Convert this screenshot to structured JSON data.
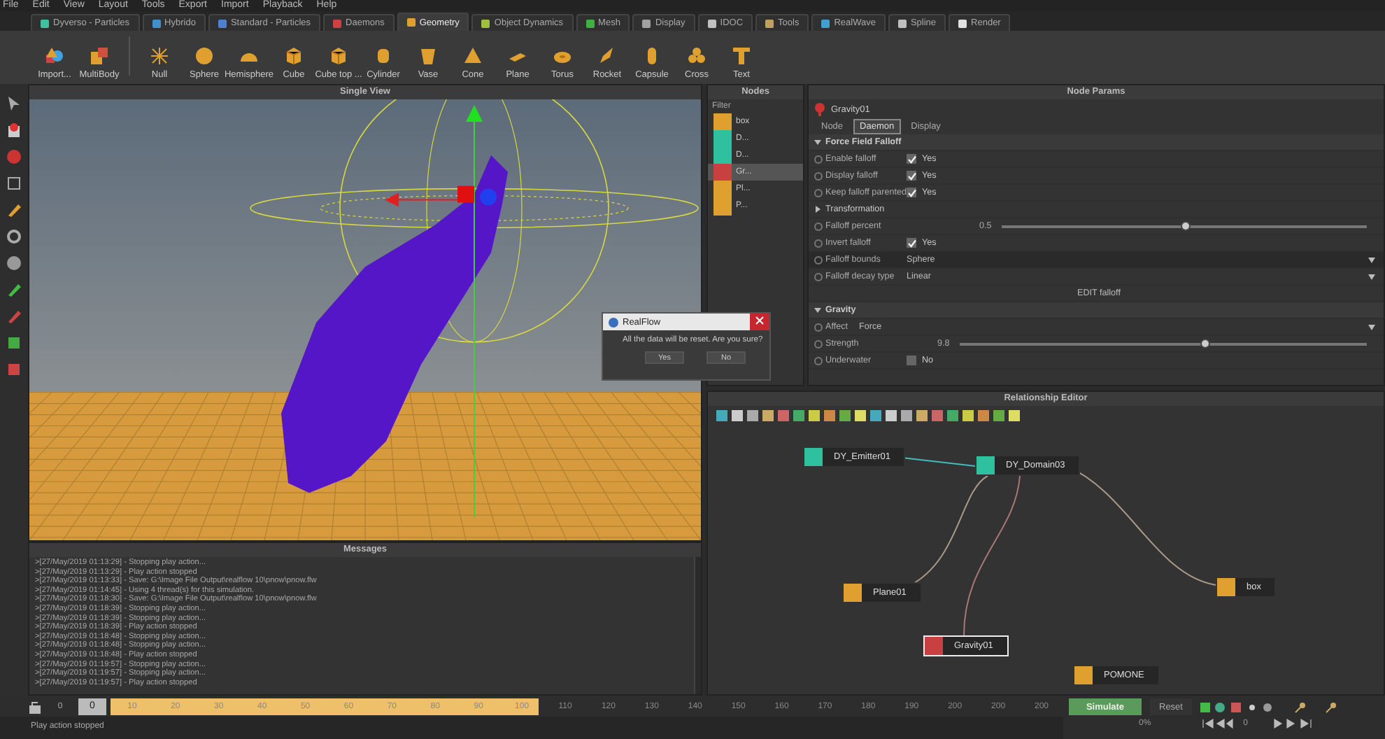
{
  "menu": [
    "File",
    "Edit",
    "View",
    "Layout",
    "Tools",
    "Export",
    "Import",
    "Playback",
    "Help"
  ],
  "tabs": [
    {
      "label": "Dyverso - Particles",
      "selected": false,
      "color": "#3fc0a0"
    },
    {
      "label": "Hybrido",
      "selected": false,
      "color": "#4090d0"
    },
    {
      "label": "Standard - Particles",
      "selected": false,
      "color": "#5080d0"
    },
    {
      "label": "Daemons",
      "selected": false,
      "color": "#d04040"
    },
    {
      "label": "Geometry",
      "selected": true,
      "color": "#e0a030"
    },
    {
      "label": "Object Dynamics",
      "selected": false,
      "color": "#a0c040"
    },
    {
      "label": "Mesh",
      "selected": false,
      "color": "#40b040"
    },
    {
      "label": "Display",
      "selected": false,
      "color": "#a0a0a0"
    },
    {
      "label": "IDOC",
      "selected": false,
      "color": "#c0c0c0"
    },
    {
      "label": "Tools",
      "selected": false,
      "color": "#c0a060"
    },
    {
      "label": "RealWave",
      "selected": false,
      "color": "#40a0d0"
    },
    {
      "label": "Spline",
      "selected": false,
      "color": "#c0c0c0"
    },
    {
      "label": "Render",
      "selected": false,
      "color": "#e0e0e0"
    }
  ],
  "toolbar": [
    {
      "label": "Import...",
      "kind": "import"
    },
    {
      "label": "MultiBody",
      "kind": "multibody"
    },
    {
      "label": "Null",
      "kind": "null"
    },
    {
      "label": "Sphere",
      "kind": "sphere"
    },
    {
      "label": "Hemisphere",
      "kind": "hemisphere"
    },
    {
      "label": "Cube",
      "kind": "cube"
    },
    {
      "label": "Cube top ...",
      "kind": "cube"
    },
    {
      "label": "Cylinder",
      "kind": "cylinder"
    },
    {
      "label": "Vase",
      "kind": "vase"
    },
    {
      "label": "Cone",
      "kind": "cone"
    },
    {
      "label": "Plane",
      "kind": "plane"
    },
    {
      "label": "Torus",
      "kind": "torus"
    },
    {
      "label": "Rocket",
      "kind": "rocket"
    },
    {
      "label": "Capsule",
      "kind": "capsule"
    },
    {
      "label": "Cross",
      "kind": "cross"
    },
    {
      "label": "Text",
      "kind": "text"
    }
  ],
  "viewport": {
    "title": "Single View"
  },
  "messages": {
    "title": "Messages",
    "lines": [
      ">[27/May/2019 01:13:29] - Stopping play action...",
      ">[27/May/2019 01:13:29] - Play action stopped",
      ">[27/May/2019 01:13:33] - Save: G:\\Image File Output\\realflow 10\\pnow\\pnow.flw",
      ">[27/May/2019 01:14:45] - Using 4 thread(s) for this simulation.",
      ">[27/May/2019 01:18:30] - Save: G:\\Image File Output\\realflow 10\\pnow\\pnow.flw",
      ">[27/May/2019 01:18:39] - Stopping play action...",
      ">[27/May/2019 01:18:39] - Stopping play action...",
      ">[27/May/2019 01:18:39] - Play action stopped",
      ">[27/May/2019 01:18:48] - Stopping play action...",
      ">[27/May/2019 01:18:48] - Stopping play action...",
      ">[27/May/2019 01:18:48] - Play action stopped",
      ">[27/May/2019 01:19:57] - Stopping play action...",
      ">[27/May/2019 01:19:57] - Stopping play action...",
      ">[27/May/2019 01:19:57] - Play action stopped"
    ]
  },
  "nodes": {
    "title": "Nodes",
    "filter": "Filter",
    "items": [
      {
        "label": "box",
        "kind": "object",
        "selected": false
      },
      {
        "label": "D...",
        "kind": "domain",
        "selected": false
      },
      {
        "label": "D...",
        "kind": "emitter",
        "selected": false
      },
      {
        "label": "Gr...",
        "kind": "daemon",
        "selected": true
      },
      {
        "label": "Pl...",
        "kind": "plane",
        "selected": false
      },
      {
        "label": "P...",
        "kind": "object",
        "selected": false
      }
    ]
  },
  "node_params": {
    "title": "Node Params",
    "node": "Gravity01",
    "tabs": [
      {
        "label": "Node",
        "selected": false
      },
      {
        "label": "Daemon",
        "selected": true
      },
      {
        "label": "Display",
        "selected": false
      }
    ],
    "rows": [
      {
        "kind": "section",
        "label": "Force Field Falloff",
        "expanded": true
      },
      {
        "kind": "check",
        "label": "Enable falloff",
        "checked": true,
        "value": "Yes"
      },
      {
        "kind": "check",
        "label": "Display falloff",
        "checked": true,
        "value": "Yes"
      },
      {
        "kind": "check",
        "label": "Keep falloff parented",
        "checked": true,
        "value": "Yes"
      },
      {
        "kind": "group",
        "label": "Transformation",
        "expanded": false
      },
      {
        "kind": "slider",
        "label": "Falloff percent",
        "value": "0.5",
        "level": 0.5
      },
      {
        "kind": "check",
        "label": "Invert falloff",
        "checked": true,
        "value": "Yes"
      },
      {
        "kind": "select",
        "label": "Falloff bounds",
        "value": "Sphere"
      },
      {
        "kind": "select",
        "label": "Falloff decay type",
        "value": "Linear"
      },
      {
        "kind": "button",
        "label": "EDIT falloff"
      },
      {
        "kind": "section",
        "label": "Gravity",
        "expanded": true
      },
      {
        "kind": "select",
        "label": "Affect",
        "value": "Force"
      },
      {
        "kind": "slider",
        "label": "Strength",
        "value": "9.8",
        "level": 0.6
      },
      {
        "kind": "check",
        "label": "Underwater",
        "checked": false,
        "value": "No"
      }
    ]
  },
  "relationship_editor": {
    "title": "Relationship Editor",
    "nodes": [
      {
        "label": "DY_Emitter01",
        "kind": "emitter",
        "selected": false
      },
      {
        "label": "DY_Domain03",
        "kind": "domain",
        "selected": false
      },
      {
        "label": "Plane01",
        "kind": "plane",
        "selected": false
      },
      {
        "label": "Gravity01",
        "kind": "daemon",
        "selected": true
      },
      {
        "label": "box",
        "kind": "object",
        "selected": false
      },
      {
        "label": "POMONE",
        "kind": "object",
        "selected": false
      }
    ]
  },
  "dialog": {
    "title": "RealFlow",
    "message": "All the data will be reset. Are you sure?",
    "buttons": [
      "Yes",
      "No"
    ]
  },
  "timeline": {
    "frame": "0",
    "current": "0",
    "level": 0.45,
    "ticks": [
      "10",
      "20",
      "30",
      "40",
      "50",
      "60",
      "70",
      "80",
      "90",
      "100",
      "110",
      "120",
      "130",
      "140",
      "150",
      "160",
      "170",
      "180",
      "190",
      "200",
      "200",
      "200"
    ]
  },
  "controls": {
    "simulate": "Simulate",
    "reset": "Reset",
    "progress": "0%",
    "frame": "0"
  },
  "status": "Play action stopped"
}
